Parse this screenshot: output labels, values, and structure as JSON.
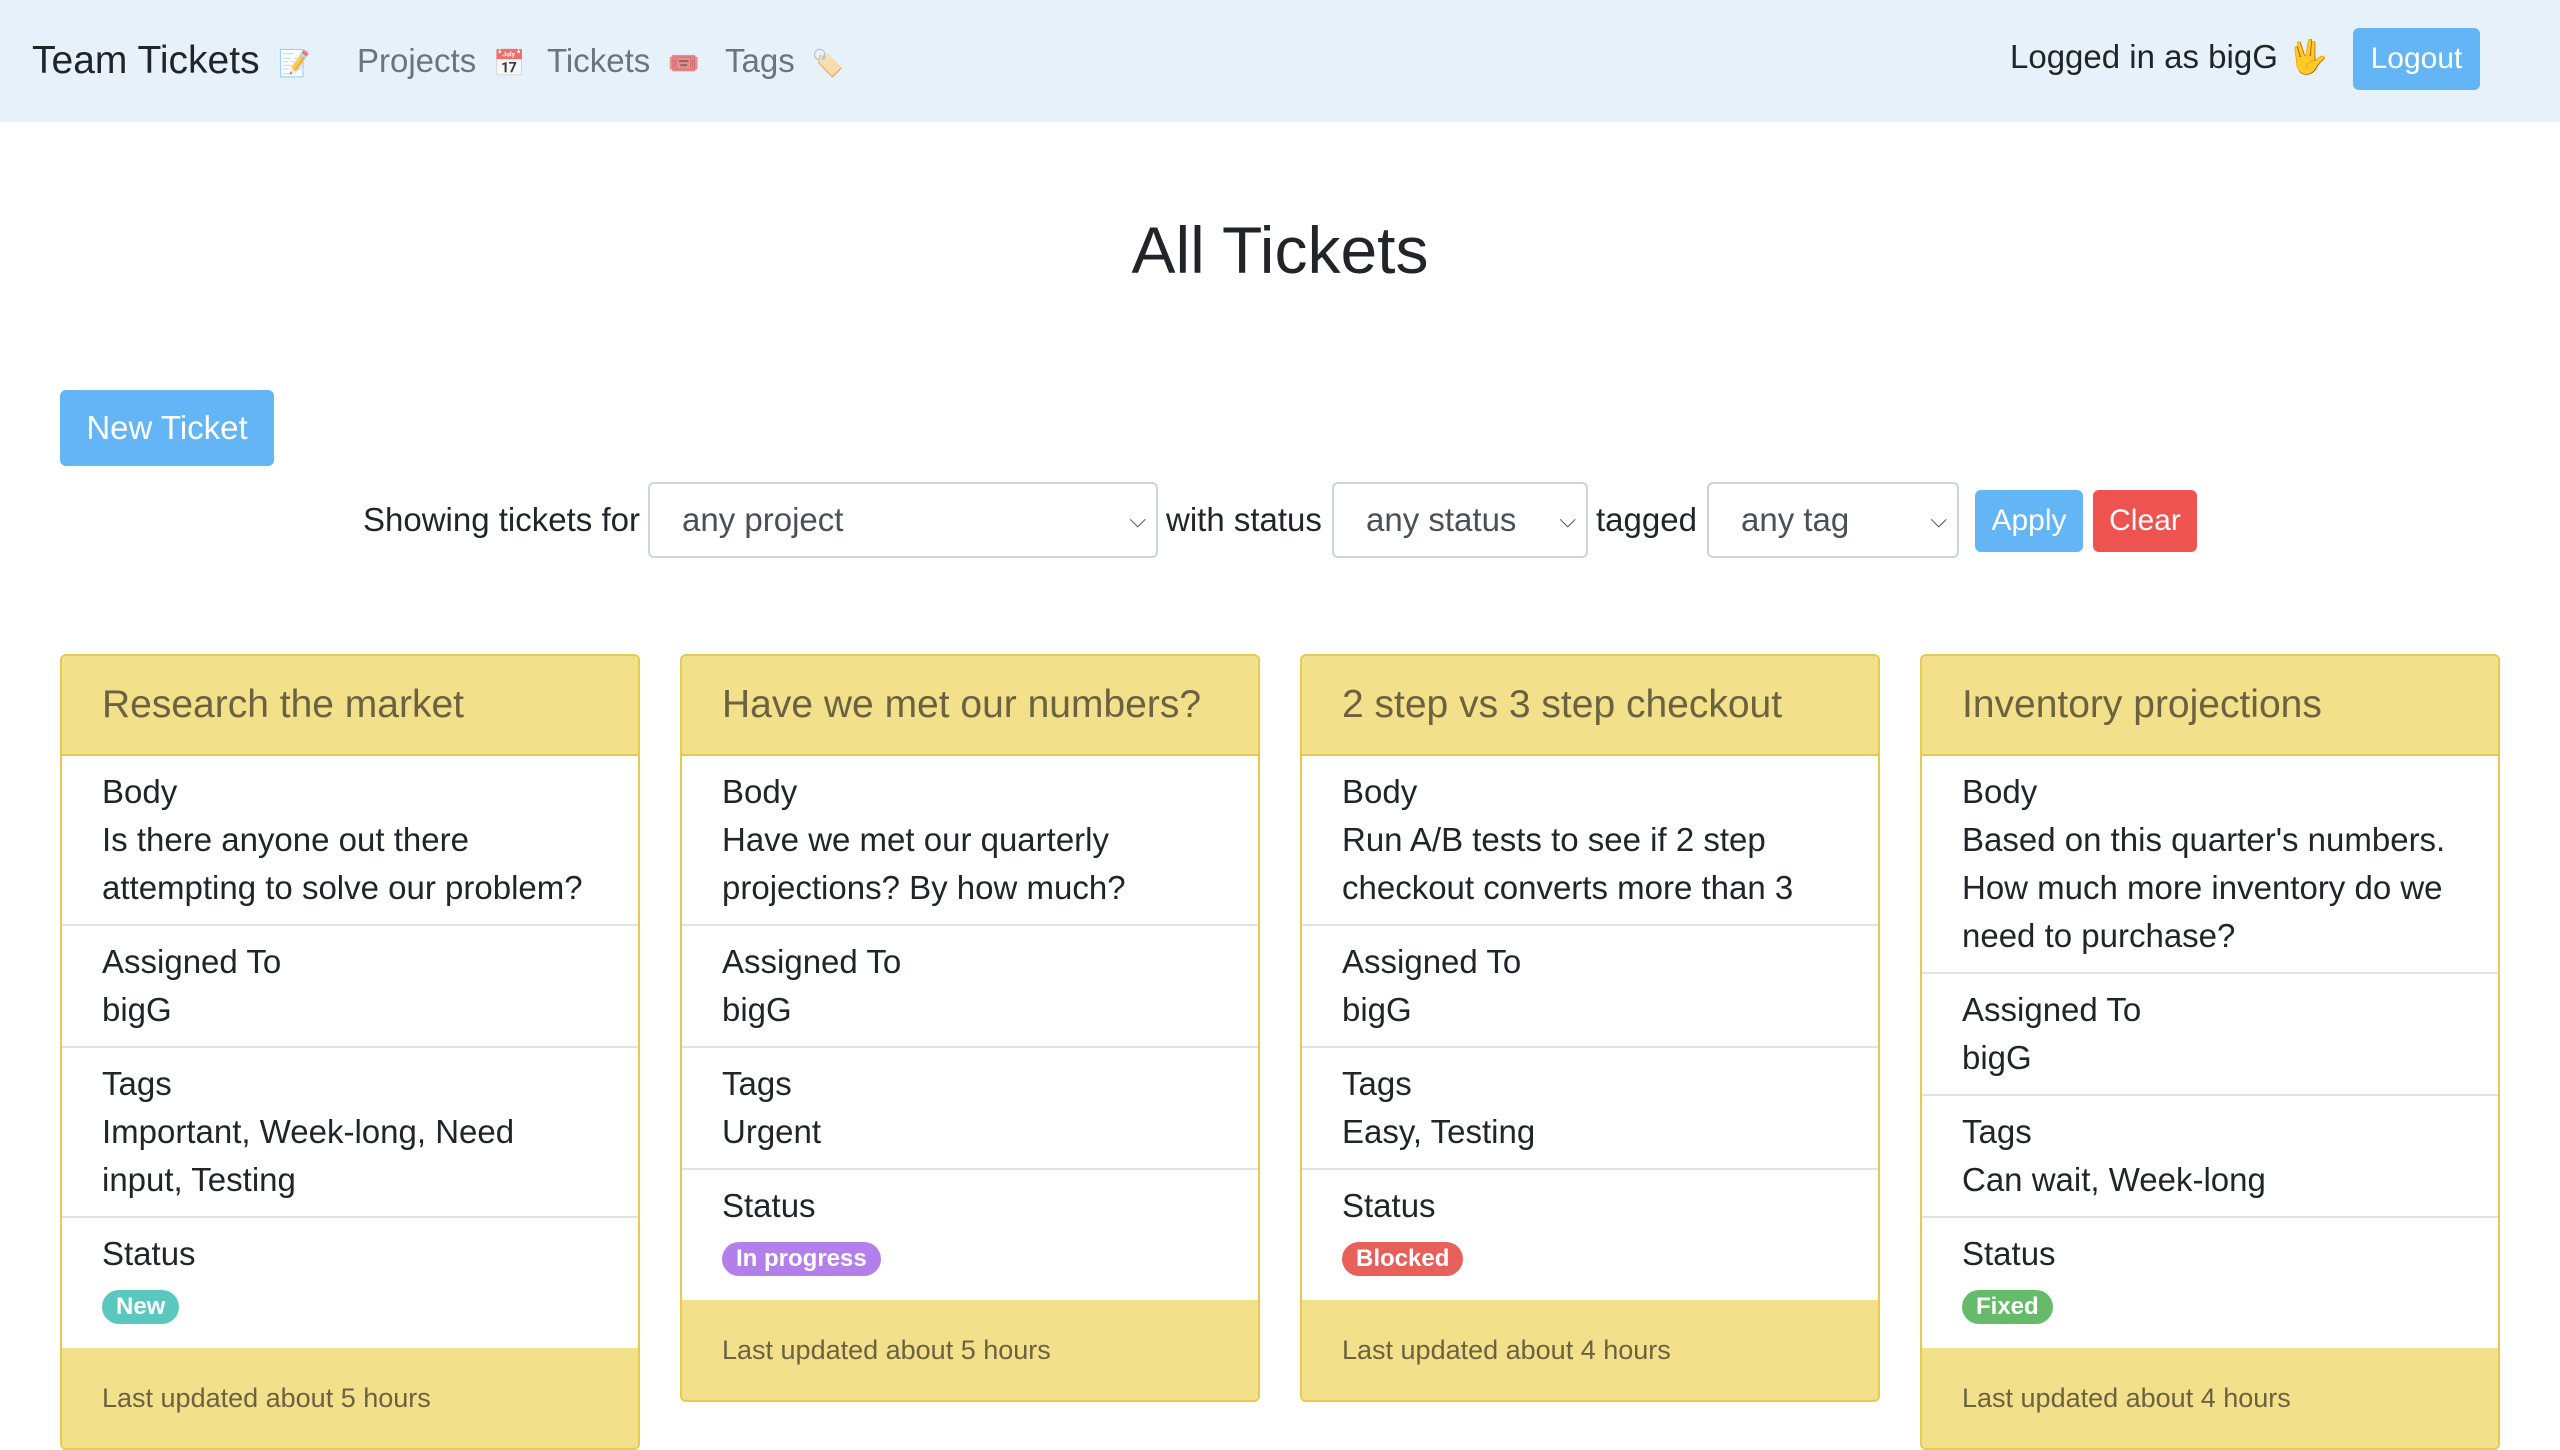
{
  "navbar": {
    "brand": "Team Tickets",
    "brand_emoji": "📝",
    "links": [
      {
        "label": "Projects",
        "emoji": "📅"
      },
      {
        "label": "Tickets",
        "emoji": "🎟️"
      },
      {
        "label": "Tags",
        "emoji": "🏷️"
      }
    ],
    "user_text": "Logged in as bigG 🖖",
    "logout_label": "Logout"
  },
  "page": {
    "title": "All Tickets",
    "new_ticket_label": "New Ticket"
  },
  "filters": {
    "showing_label": "Showing tickets for",
    "project_value": "any project",
    "status_label": "with status",
    "status_value": "any status",
    "tag_label": "tagged",
    "tag_value": "any tag",
    "apply_label": "Apply",
    "clear_label": "Clear"
  },
  "labels": {
    "body": "Body",
    "assigned": "Assigned To",
    "tags": "Tags",
    "status": "Status"
  },
  "tickets": [
    {
      "title": "Research the market",
      "body": "Is there anyone out there attempting to solve our problem?",
      "assigned": "bigG",
      "tags": "Important, Week-long, Need input, Testing",
      "status": "New",
      "status_color": "#5bc8c0",
      "updated": "Last updated about 5 hours"
    },
    {
      "title": "Have we met our numbers?",
      "body": "Have we met our quarterly projections? By how much?",
      "assigned": "bigG",
      "tags": "Urgent",
      "status": "In progress",
      "status_color": "#b37feb",
      "updated": "Last updated about 5 hours"
    },
    {
      "title": "2 step vs 3 step checkout",
      "body": "Run A/B tests to see if 2 step checkout converts more than 3",
      "assigned": "bigG",
      "tags": "Easy, Testing",
      "status": "Blocked",
      "status_color": "#e8605a",
      "updated": "Last updated about 4 hours"
    },
    {
      "title": "Inventory projections",
      "body": "Based on this quarter's numbers. How much more inventory do we need to purchase?",
      "assigned": "bigG",
      "tags": "Can wait, Week-long",
      "status": "Fixed",
      "status_color": "#66bb6a",
      "updated": "Last updated about 4 hours"
    }
  ]
}
